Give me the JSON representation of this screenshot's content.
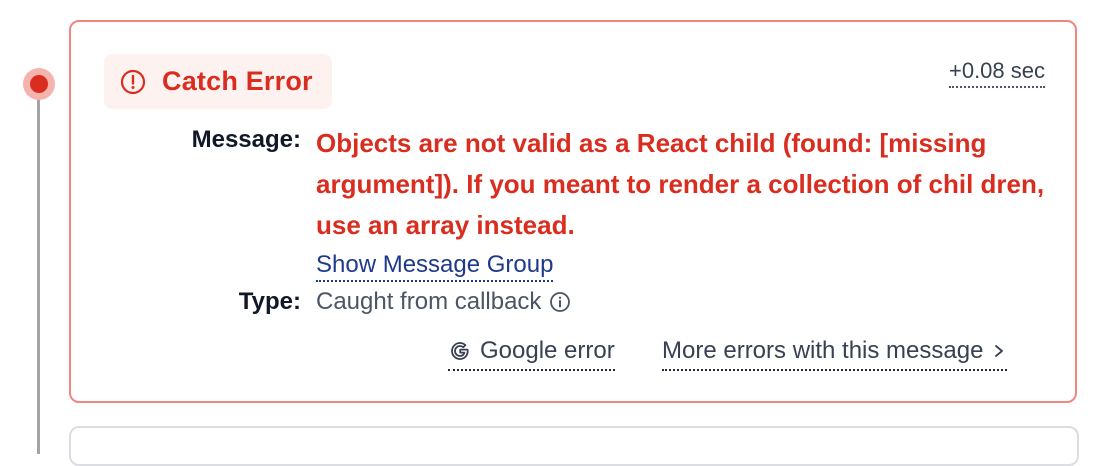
{
  "event": {
    "badge_label": "Catch Error",
    "badge_icon": "alert-circle-icon",
    "timestamp": "+0.08 sec",
    "message_label": "Message:",
    "message": "Objects are not valid as a React child (found: [missing argument]). If you meant to render a collection of chil dren, use an array instead.",
    "show_group_link": "Show Message Group",
    "type_label": "Type:",
    "type_value": "Caught from callback",
    "google_link": "Google error",
    "more_errors_link": "More errors with this message"
  },
  "colors": {
    "error": "#d92d20",
    "card_border": "#f0877e",
    "badge_bg": "#fef2f0",
    "link": "#1e3a8a",
    "timeline": "#a3a3a8"
  }
}
